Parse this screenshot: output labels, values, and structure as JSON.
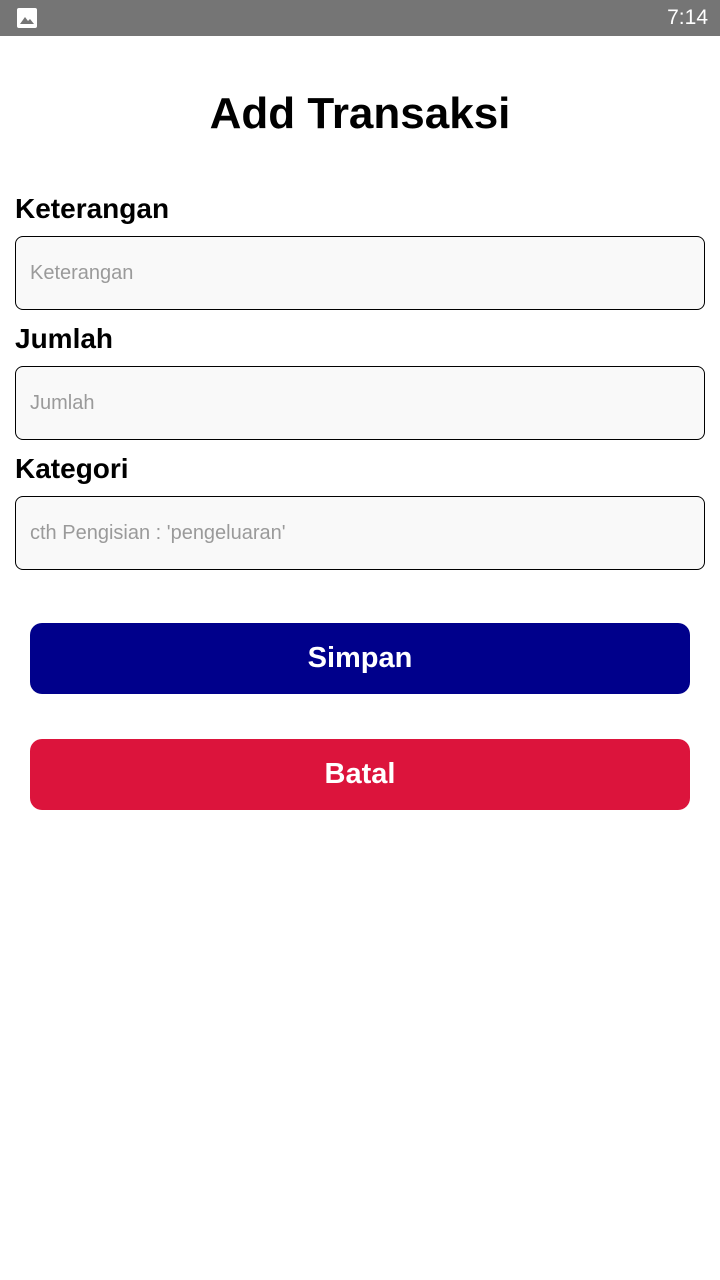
{
  "status_bar": {
    "time": "7:14",
    "notification_icon": "image-icon"
  },
  "page": {
    "title": "Add Transaksi"
  },
  "form": {
    "keterangan": {
      "label": "Keterangan",
      "placeholder": "Keterangan",
      "value": ""
    },
    "jumlah": {
      "label": "Jumlah",
      "placeholder": "Jumlah",
      "value": ""
    },
    "kategori": {
      "label": "Kategori",
      "placeholder": "cth Pengisian : 'pengeluaran'",
      "value": ""
    }
  },
  "actions": {
    "save_label": "Simpan",
    "cancel_label": "Batal"
  },
  "colors": {
    "status_bar": "#757575",
    "save_button": "#00008B",
    "cancel_button": "#DC143C",
    "input_background": "#F9F9F9"
  }
}
